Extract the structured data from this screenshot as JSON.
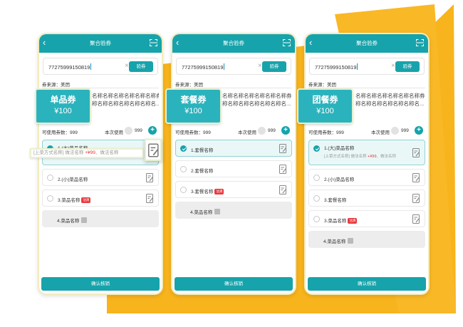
{
  "screen": {
    "title": "聚合验券",
    "code": "77275999150819",
    "verify_label": "验券",
    "clear_icon": "close-icon",
    "source": "券来源：美团",
    "available": "可使用券数：999",
    "use_label": "本次使用",
    "use_value": "999",
    "confirm_label": "确认核销"
  },
  "coupons": [
    {
      "name": "单品券",
      "price": "¥100"
    },
    {
      "name": "套餐券",
      "price": "¥100"
    },
    {
      "name": "团餐券",
      "price": "¥100"
    }
  ],
  "title_lines": [
    "名称名称名称名称名称名称券名",
    "称名称名称名称名称名称名..."
  ],
  "phone1_items": [
    {
      "label": "1.(大)菜品名称",
      "sub_a": "[上菜方式名称] 做法名称",
      "sub_price": "+¥99",
      "sub_b": "、做法名称"
    },
    {
      "label": "2.(小)菜品名称"
    },
    {
      "label": "3.菜品名称",
      "badge": "沽清"
    },
    {
      "label": "4.菜品名称"
    }
  ],
  "phone2_items": [
    {
      "label": "1.套餐名称"
    },
    {
      "label": "2.套餐名称"
    },
    {
      "label": "3.套餐名称",
      "badge": "沽清"
    },
    {
      "label": "4.菜品名称"
    }
  ],
  "phone3_items": [
    {
      "label": "1.(大)菜品名称",
      "sub_a": "[上菜方式名称] 做法名称",
      "sub_price": "+¥99",
      "sub_b": "、做法名称"
    },
    {
      "label": "2.(小)菜品名称"
    },
    {
      "label": "3.套餐名称"
    },
    {
      "label": "3.菜品名称",
      "badge": "沽清"
    },
    {
      "label": "4.菜品名称"
    }
  ],
  "callout": {
    "sub_a": "[上菜方式名称]  做法名称",
    "sub_price": "+¥99",
    "sub_b": "、做法名称"
  },
  "colors": {
    "accent": "#17a3ab",
    "background_shape": "#f8b41c",
    "price": "#e8383d"
  }
}
